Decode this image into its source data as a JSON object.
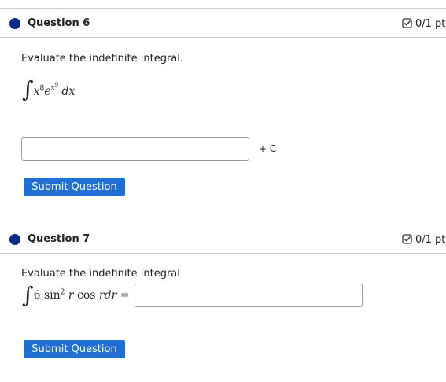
{
  "q6": {
    "title": "Question 6",
    "score": "0/1 pt",
    "prompt": "Evaluate the indefinite integral.",
    "integral": {
      "symbol": "∫",
      "base1": "x",
      "exp1": "8",
      "base2": "e",
      "exp2_base": "x",
      "exp2_exp": "9",
      "dx": "dx"
    },
    "answer_value": "",
    "plus_c": "+ C",
    "submit_label": "Submit Question"
  },
  "q7": {
    "title": "Question 7",
    "score": "0/1 pt",
    "prompt": "Evaluate the indefinite integral",
    "integral": {
      "symbol": "∫",
      "coef": "6",
      "func1": "sin",
      "func1_exp": "2",
      "var1": "r",
      "func2": "cos",
      "var2": "r",
      "dr": "dr",
      "equals": "="
    },
    "answer_value": "",
    "submit_label": "Submit Question"
  },
  "icons": {
    "score_icon": "check-box-icon",
    "question_marker": "question-dot-icon"
  },
  "colors": {
    "button": "#1f6fd6",
    "dot": "#0a2a8a"
  }
}
